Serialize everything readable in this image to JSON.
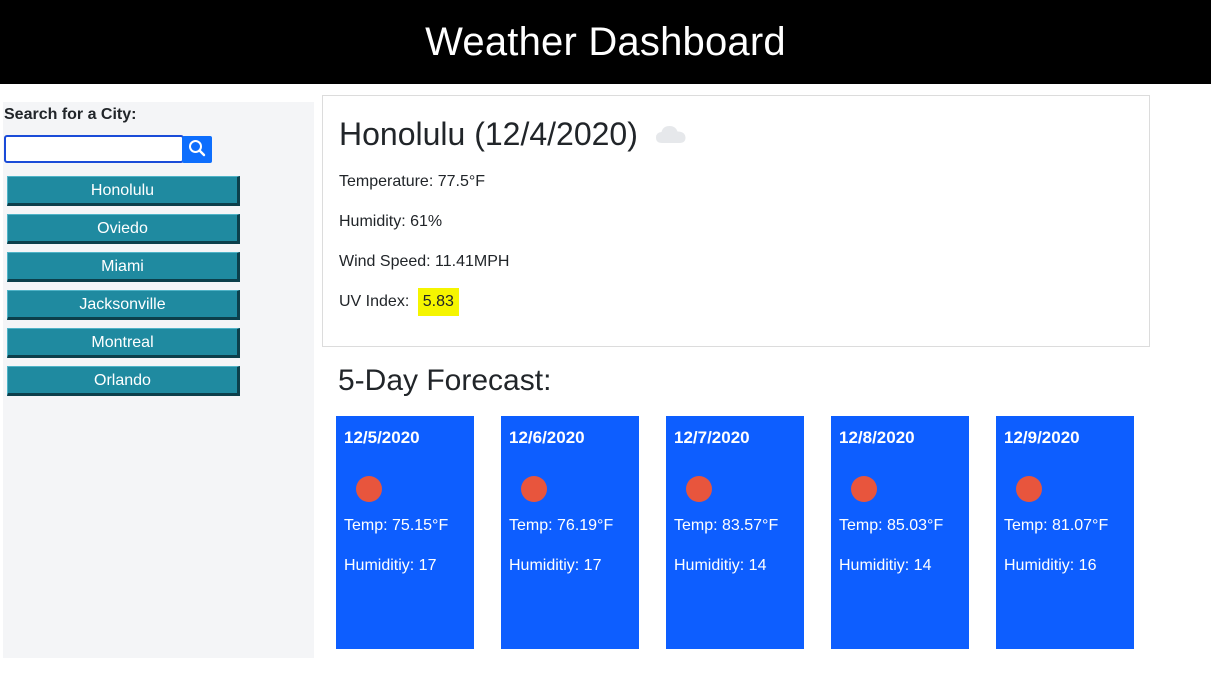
{
  "header": {
    "title": "Weather Dashboard"
  },
  "sidebar": {
    "search_label": "Search for a City:",
    "search_value": "",
    "search_icon": "search-icon",
    "cities": [
      "Honolulu",
      "Oviedo",
      "Miami",
      "Jacksonville",
      "Montreal",
      "Orlando"
    ]
  },
  "current": {
    "title": "Honolulu (12/4/2020)",
    "icon": "cloud-icon",
    "temperature": "Temperature: 77.5°F",
    "humidity": "Humidity: 61%",
    "wind": "Wind Speed: 11.41MPH",
    "uv_label": "UV Index:",
    "uv_value": "5.83",
    "uv_color": "#f5f500"
  },
  "forecast": {
    "title": "5-Day Forecast:",
    "card_color": "#0d5eff",
    "days": [
      {
        "date": "12/5/2020",
        "icon": "sun-icon",
        "temp": "Temp: 75.15°F",
        "humidity": "Humiditiy: 17"
      },
      {
        "date": "12/6/2020",
        "icon": "sun-icon",
        "temp": "Temp: 76.19°F",
        "humidity": "Humiditiy: 17"
      },
      {
        "date": "12/7/2020",
        "icon": "sun-icon",
        "temp": "Temp: 83.57°F",
        "humidity": "Humiditiy: 14"
      },
      {
        "date": "12/8/2020",
        "icon": "sun-icon",
        "temp": "Temp: 85.03°F",
        "humidity": "Humiditiy: 14"
      },
      {
        "date": "12/9/2020",
        "icon": "sun-icon",
        "temp": "Temp: 81.07°F",
        "humidity": "Humiditiy: 16"
      }
    ]
  }
}
